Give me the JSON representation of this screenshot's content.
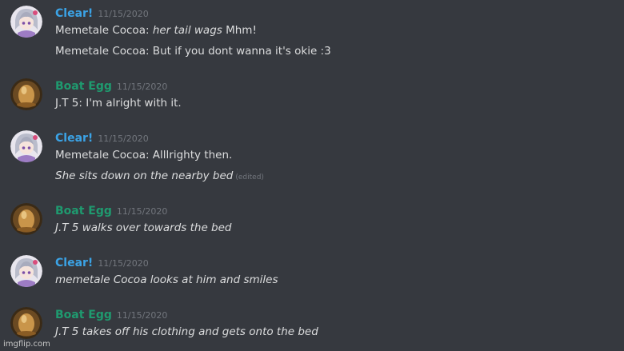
{
  "colors": {
    "background": "#36393f",
    "text": "#dcddde",
    "timestamp": "#72767d",
    "clear_name": "#3ba3e6",
    "boat_egg_name": "#1f9a6f"
  },
  "messages": [
    {
      "author": "Clear!",
      "author_color": "#3ba3e6",
      "avatar": "anime-girl-avatar",
      "timestamp": "11/15/2020",
      "lines": [
        {
          "prefix": "Memetale Cocoa: ",
          "italic": "her tail wags",
          "suffix": " Mhm!"
        },
        {
          "prefix": "Memetale Cocoa: But if you dont wanna it's okie :3",
          "italic": "",
          "suffix": ""
        }
      ]
    },
    {
      "author": "Boat Egg",
      "author_color": "#1f9a6f",
      "avatar": "egg-avatar",
      "timestamp": "11/15/2020",
      "lines": [
        {
          "prefix": "J.T 5: I'm alright with it.",
          "italic": "",
          "suffix": ""
        }
      ]
    },
    {
      "author": "Clear!",
      "author_color": "#3ba3e6",
      "avatar": "anime-girl-avatar",
      "timestamp": "11/15/2020",
      "lines": [
        {
          "prefix": "Memetale Cocoa: Alllrighty then.",
          "italic": "",
          "suffix": ""
        },
        {
          "prefix": "",
          "italic": "She sits down on the nearby bed",
          "suffix": "",
          "edited": "(edited)"
        }
      ]
    },
    {
      "author": "Boat Egg",
      "author_color": "#1f9a6f",
      "avatar": "egg-avatar",
      "timestamp": "11/15/2020",
      "lines": [
        {
          "prefix": "",
          "italic": "J.T 5 walks over towards the bed",
          "suffix": ""
        }
      ]
    },
    {
      "author": "Clear!",
      "author_color": "#3ba3e6",
      "avatar": "anime-girl-avatar",
      "timestamp": "11/15/2020",
      "lines": [
        {
          "prefix": "",
          "italic": "memetale Cocoa looks at him and smiles",
          "suffix": ""
        }
      ]
    },
    {
      "author": "Boat Egg",
      "author_color": "#1f9a6f",
      "avatar": "egg-avatar",
      "timestamp": "11/15/2020",
      "lines": [
        {
          "prefix": "",
          "italic": "J.T 5 takes off his clothing and gets onto the bed",
          "suffix": ""
        }
      ]
    }
  ],
  "watermark": "imgflip.com"
}
